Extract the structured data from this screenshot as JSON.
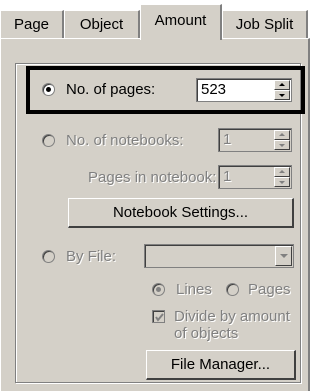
{
  "tabs": [
    {
      "label": "Page",
      "active": false
    },
    {
      "label": "Object",
      "active": false
    },
    {
      "label": "Amount",
      "active": true
    },
    {
      "label": "Job Split",
      "active": false
    }
  ],
  "amount": {
    "no_of_pages": {
      "label": "No. of pages:",
      "value": "523",
      "selected": true
    },
    "no_of_notebooks": {
      "label": "No. of notebooks:",
      "value": "1",
      "selected": false
    },
    "pages_in_notebook": {
      "label": "Pages in notebook:",
      "value": "1"
    },
    "notebook_settings_button": "Notebook Settings...",
    "by_file": {
      "label": "By File:",
      "value": "",
      "selected": false
    },
    "lines_option": {
      "label": "Lines",
      "selected": true
    },
    "pages_option": {
      "label": "Pages",
      "selected": false
    },
    "divide_checkbox": {
      "line1": "Divide by amount",
      "line2": "of objects",
      "checked": true
    },
    "file_manager_button": "File Manager..."
  },
  "colors": {
    "panel_bg": "#d4d0c8",
    "disabled_text": "#808080",
    "highlight_border": "#000000"
  }
}
